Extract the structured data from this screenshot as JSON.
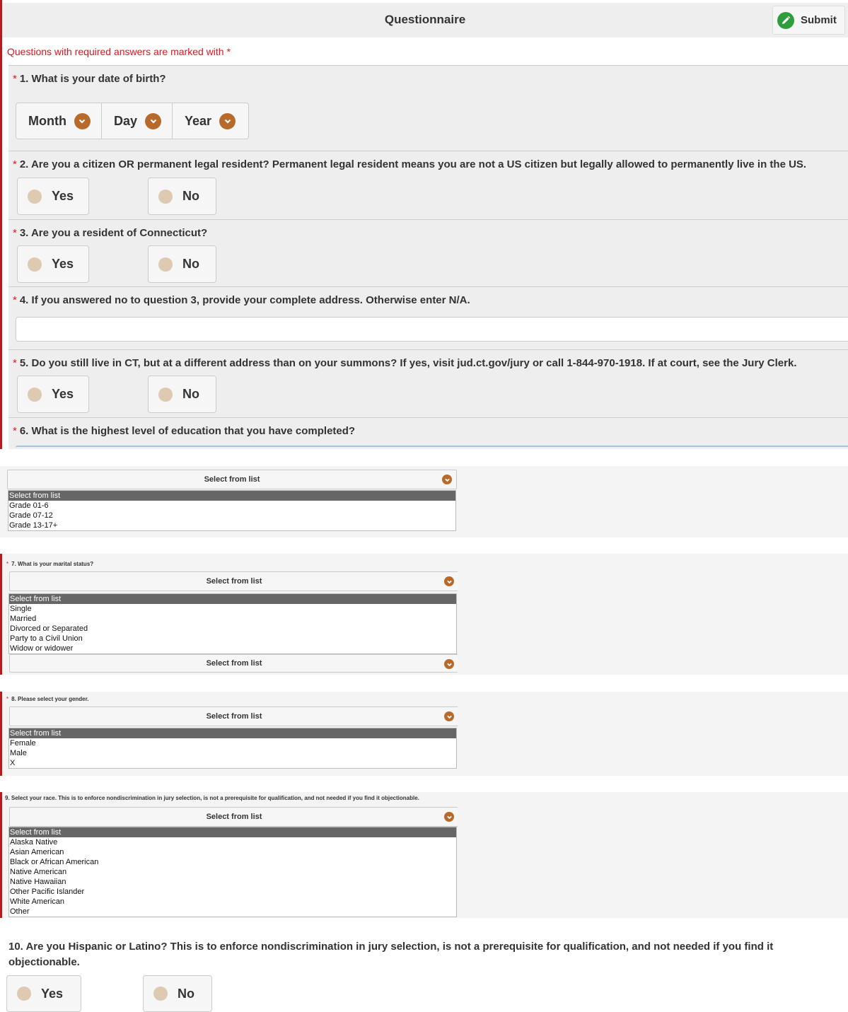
{
  "header": {
    "title": "Questionnaire",
    "submit_label": "Submit"
  },
  "required_note": "Questions with required answers are marked with *",
  "q1": {
    "star": "*",
    "text": "1.  What is your date of birth?",
    "month": "Month",
    "day": "Day",
    "year": "Year"
  },
  "q2": {
    "star": "*",
    "text": "2.  Are you a citizen OR permanent legal resident? Permanent legal resident means you are not a US citizen but legally allowed to permanently live in the US.",
    "yes": "Yes",
    "no": "No"
  },
  "q3": {
    "star": "*",
    "text": "3.  Are you a resident of Connecticut?",
    "yes": "Yes",
    "no": "No"
  },
  "q4": {
    "star": "*",
    "text": "4.  If you answered no to question 3, provide your complete address. Otherwise enter N/A.",
    "value": ""
  },
  "q5": {
    "star": "*",
    "text": "5.  Do you still live in CT, but at a different address than on your summons? If yes, visit jud.ct.gov/jury or call 1-844-970-1918. If at court, see the Jury Clerk.",
    "yes": "Yes",
    "no": "No"
  },
  "q6": {
    "star": "*",
    "text": "6.  What is the highest level of education that you have completed?",
    "select_label": "Select from list",
    "options": [
      "Select from list",
      "Grade 01-6",
      "Grade 07-12",
      "Grade 13-17+"
    ]
  },
  "q7": {
    "star": "*",
    "text": "7.  What is your marital status?",
    "select_label": "Select from list",
    "select_label_below": "Select from list",
    "options": [
      "Select from list",
      "Single",
      "Married",
      "Divorced or Separated",
      "Party to a Civil Union",
      "Widow or widower"
    ]
  },
  "q8": {
    "star": "*",
    "text": "8.  Please select your gender.",
    "select_label": "Select from list",
    "options": [
      "Select from list",
      "Female",
      "Male",
      "X"
    ]
  },
  "q9": {
    "text": "9.  Select your race. This is to enforce nondiscrimination in jury selection, is not a prerequisite for qualification, and not needed if you find it objectionable.",
    "select_label": "Select from list",
    "options": [
      "Select from list",
      "Alaska Native",
      "Asian American",
      "Black or African American",
      "Native American",
      "Native Hawaiian",
      "Other Pacific Islander",
      "White American",
      "Other"
    ]
  },
  "q10": {
    "text": "10.  Are you Hispanic or Latino? This is to enforce nondiscrimination in jury selection, is not a prerequisite for qualification, and not needed if you find it objectionable.",
    "yes": "Yes",
    "no": "No"
  },
  "colors": {
    "required": "#e0141e",
    "chevron": "#b8692c",
    "submit_icon": "#2e9e3c",
    "radio": "#dec9b3",
    "left_bar": "#b71c1c"
  }
}
